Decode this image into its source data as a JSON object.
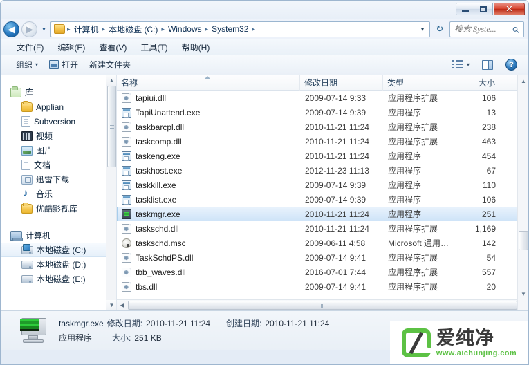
{
  "window": {
    "buttons": {
      "minimize": "—",
      "maximize": "□",
      "close": "✕"
    }
  },
  "address": {
    "back_glyph": "◀",
    "forward_glyph": "▶",
    "history_caret": "▾",
    "dropdown_caret": "▾",
    "refresh_glyph": "↻",
    "breadcrumbs": [
      "计算机",
      "本地磁盘 (C:)",
      "Windows",
      "System32"
    ],
    "separator": "▸"
  },
  "search": {
    "placeholder": "搜索 Syste...",
    "icon_glyph": "⚲"
  },
  "menubar": {
    "items": [
      "文件(F)",
      "编辑(E)",
      "查看(V)",
      "工具(T)",
      "帮助(H)"
    ]
  },
  "toolbar": {
    "organize_label": "组织",
    "caret": "▾",
    "open_label": "打开",
    "new_folder_label": "新建文件夹",
    "help_glyph": "?"
  },
  "sidebar": {
    "items": [
      {
        "label": "库",
        "icon": "library-icon",
        "level": "root",
        "selected": false
      },
      {
        "label": "Applian",
        "icon": "folder-icon",
        "level": "child",
        "selected": false
      },
      {
        "label": "Subversion",
        "icon": "document-icon",
        "level": "child",
        "selected": false
      },
      {
        "label": "视频",
        "icon": "video-icon",
        "level": "child",
        "selected": false
      },
      {
        "label": "图片",
        "icon": "pictures-icon",
        "level": "child",
        "selected": false
      },
      {
        "label": "文档",
        "icon": "documents-icon",
        "level": "child",
        "selected": false
      },
      {
        "label": "迅雷下载",
        "icon": "download-icon",
        "level": "child",
        "selected": false
      },
      {
        "label": "音乐",
        "icon": "music-icon",
        "level": "child",
        "selected": false
      },
      {
        "label": "优酷影视库",
        "icon": "folder-icon",
        "level": "child",
        "selected": false
      },
      {
        "label": "计算机",
        "icon": "computer-icon",
        "level": "root",
        "selected": false
      },
      {
        "label": "本地磁盘 (C:)",
        "icon": "windows-drive-icon",
        "level": "child",
        "selected": true
      },
      {
        "label": "本地磁盘 (D:)",
        "icon": "drive-icon",
        "level": "child",
        "selected": false
      },
      {
        "label": "本地磁盘 (E:)",
        "icon": "drive-icon",
        "level": "child",
        "selected": false
      }
    ],
    "scroll": {
      "up_glyph": "▲",
      "down_glyph": "▼"
    }
  },
  "filelist": {
    "columns": [
      {
        "key": "name",
        "label": "名称",
        "sorted": true
      },
      {
        "key": "date",
        "label": "修改日期",
        "sorted": false
      },
      {
        "key": "type",
        "label": "类型",
        "sorted": false
      },
      {
        "key": "size",
        "label": "大小",
        "sorted": false
      }
    ],
    "rows": [
      {
        "name": "tapiui.dll",
        "date": "2009-07-14 9:33",
        "type": "应用程序扩展",
        "size": "106",
        "icon": "dll-icon",
        "selected": false
      },
      {
        "name": "TapiUnattend.exe",
        "date": "2009-07-14 9:39",
        "type": "应用程序",
        "size": "13",
        "icon": "exe-icon",
        "selected": false
      },
      {
        "name": "taskbarcpl.dll",
        "date": "2010-11-21 11:24",
        "type": "应用程序扩展",
        "size": "238",
        "icon": "dll-icon",
        "selected": false
      },
      {
        "name": "taskcomp.dll",
        "date": "2010-11-21 11:24",
        "type": "应用程序扩展",
        "size": "463",
        "icon": "dll-icon",
        "selected": false
      },
      {
        "name": "taskeng.exe",
        "date": "2010-11-21 11:24",
        "type": "应用程序",
        "size": "454",
        "icon": "exe-icon",
        "selected": false
      },
      {
        "name": "taskhost.exe",
        "date": "2012-11-23 11:13",
        "type": "应用程序",
        "size": "67",
        "icon": "exe-icon",
        "selected": false
      },
      {
        "name": "taskkill.exe",
        "date": "2009-07-14 9:39",
        "type": "应用程序",
        "size": "110",
        "icon": "exe-icon",
        "selected": false
      },
      {
        "name": "tasklist.exe",
        "date": "2009-07-14 9:39",
        "type": "应用程序",
        "size": "106",
        "icon": "exe-icon",
        "selected": false
      },
      {
        "name": "taskmgr.exe",
        "date": "2010-11-21 11:24",
        "type": "应用程序",
        "size": "251",
        "icon": "taskmgr-icon",
        "selected": true
      },
      {
        "name": "taskschd.dll",
        "date": "2010-11-21 11:24",
        "type": "应用程序扩展",
        "size": "1,169",
        "icon": "dll-icon",
        "selected": false
      },
      {
        "name": "taskschd.msc",
        "date": "2009-06-11 4:58",
        "type": "Microsoft 通用管...",
        "size": "142",
        "icon": "msc-icon",
        "selected": false
      },
      {
        "name": "TaskSchdPS.dll",
        "date": "2009-07-14 9:41",
        "type": "应用程序扩展",
        "size": "54",
        "icon": "dll-icon",
        "selected": false
      },
      {
        "name": "tbb_waves.dll",
        "date": "2016-07-01 7:44",
        "type": "应用程序扩展",
        "size": "557",
        "icon": "dll-icon",
        "selected": false
      },
      {
        "name": "tbs.dll",
        "date": "2009-07-14 9:41",
        "type": "应用程序扩展",
        "size": "20",
        "icon": "dll-icon",
        "selected": false
      }
    ],
    "scroll": {
      "up_glyph": "▲",
      "down_glyph": "▼",
      "left_glyph": "◀",
      "right_glyph": "▶"
    }
  },
  "details": {
    "file_name": "taskmgr.exe",
    "modified_label": "修改日期:",
    "modified_value": "2010-11-21 11:24",
    "created_label": "创建日期:",
    "created_value": "2010-11-21 11:24",
    "type_value": "应用程序",
    "size_label": "大小:",
    "size_value": "251 KB"
  },
  "watermark": {
    "brand": "爱纯净",
    "url": "www.aichunjing.com"
  }
}
